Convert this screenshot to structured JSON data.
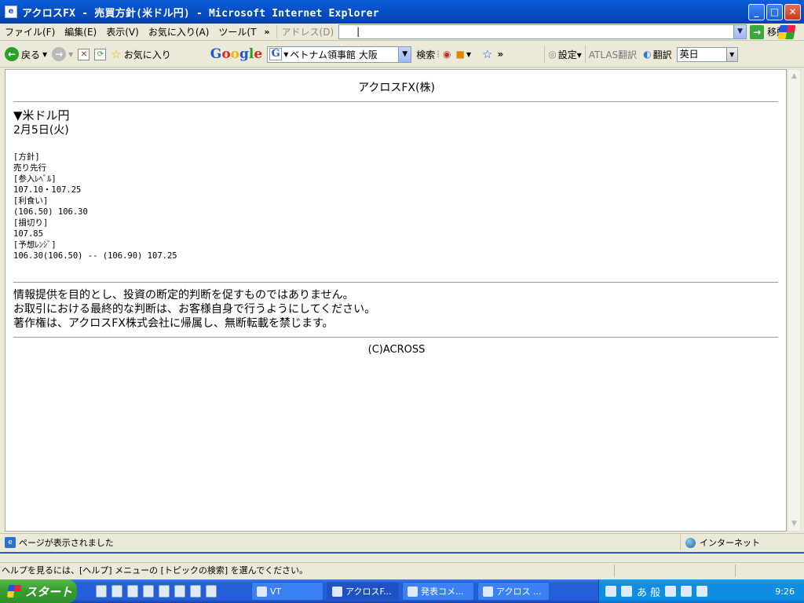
{
  "window": {
    "title": "アクロスFX - 売買方針(米ドル円) - Microsoft Internet Explorer",
    "app_icon": "ie-page-icon"
  },
  "menubar": {
    "items": [
      "ファイル(F)",
      "編集(E)",
      "表示(V)",
      "お気に入り(A)",
      "ツール(T"
    ],
    "more": "»",
    "address_label": "アドレス(D)",
    "address_value": "|",
    "go_label": "移動"
  },
  "toolbar": {
    "back_label": "戻る",
    "favorites_label": "お気に入り",
    "google_search_value": "ベトナム領事館  大阪",
    "search_label": "検索",
    "settings_label": "設定▾",
    "atlas_label": "ATLAS翻訳",
    "translate_label": "翻訳",
    "lang_value": "英日"
  },
  "page": {
    "header": "アクロスFX(株)",
    "pair": "▼米ドル円",
    "date": "2月5日(火)",
    "policy_label": "[方針]",
    "policy_value": "売り先行",
    "entry_label": "[参入ﾚﾍﾞﾙ]",
    "entry_value": "107.10・107.25",
    "profit_label": "[利食い]",
    "profit_value": "(106.50) 106.30",
    "stop_label": "[損切り]",
    "stop_value": "107.85",
    "range_label": "[予想ﾚﾝｼﾞ]",
    "range_value": "106.30(106.50) -- (106.90) 107.25",
    "disclaimer": [
      "情報提供を目的とし、投資の断定的判断を促すものではありません。",
      "お取引における最終的な判断は、お客様自身で行うようにしてください。",
      "著作権は、アクロスFX株式会社に帰属し、無断転載を禁じます。"
    ],
    "copyright": "(C)ACROSS"
  },
  "statusbar": {
    "text": "ページが表示されました",
    "zone": "インターネット"
  },
  "app_status": "ヘルプを見るには、[ヘルプ] メニューの [トピックの検索] を選んでください。",
  "taskbar": {
    "start_label": "スタート",
    "tasks": [
      "VT",
      "アクロスF...",
      "発表コメ...",
      "アクロス ..."
    ],
    "clock": "9:26",
    "ime": "あ 般"
  }
}
